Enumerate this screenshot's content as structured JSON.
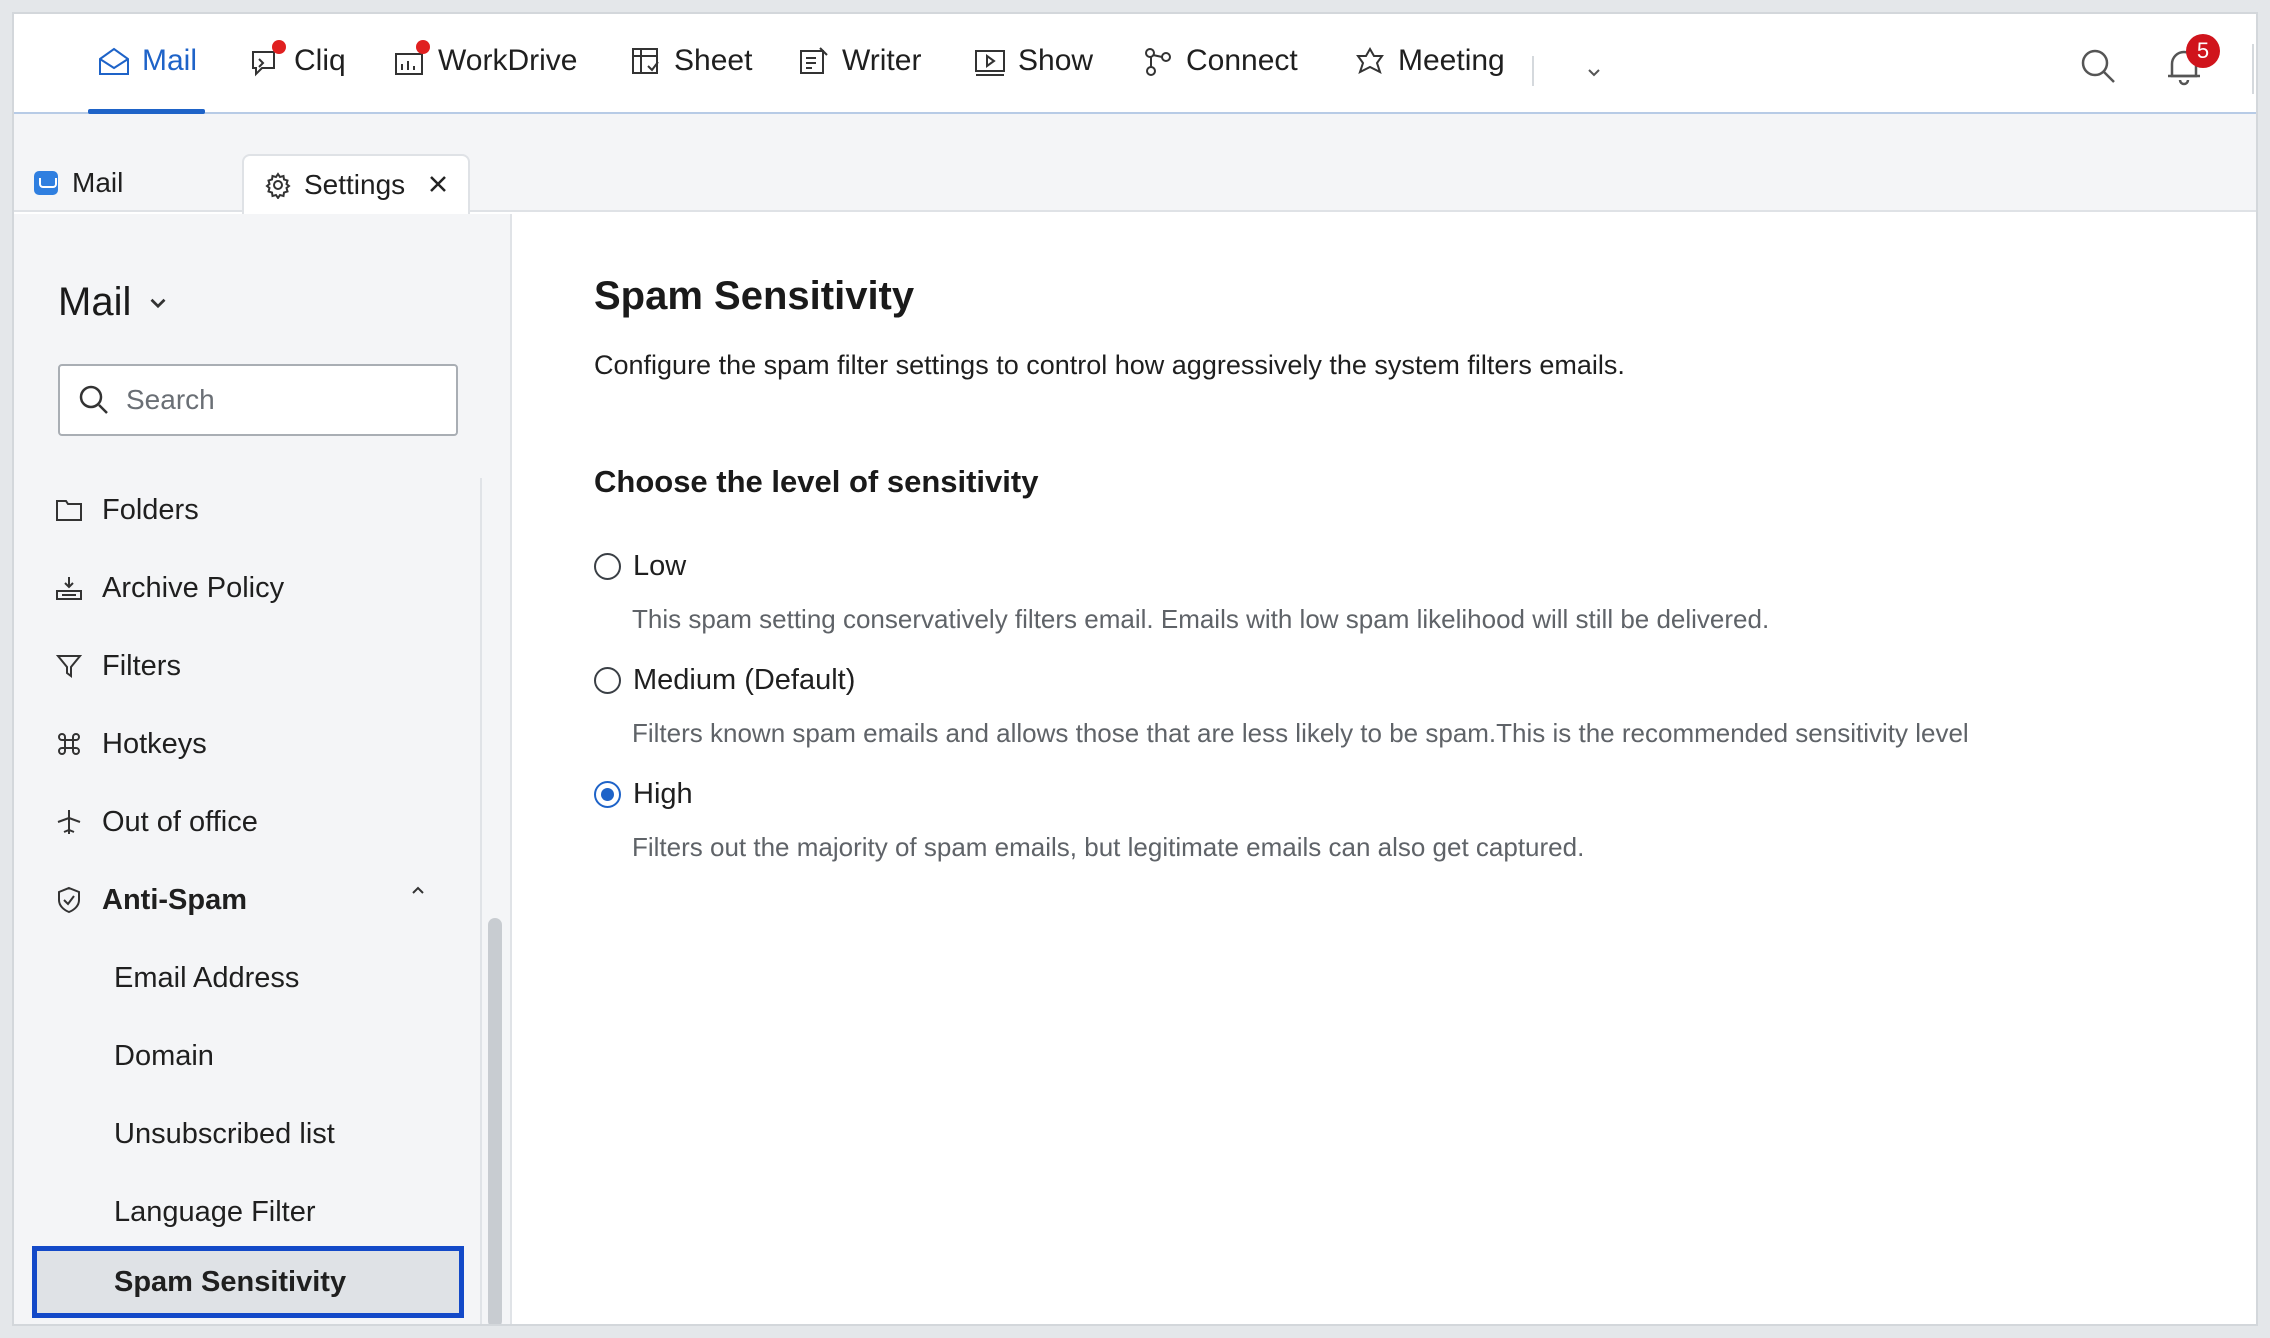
{
  "topbar": {
    "apps": [
      {
        "label": "Mail",
        "icon": "mail-app-icon",
        "active": true,
        "dot": false
      },
      {
        "label": "Cliq",
        "icon": "cliq-chat-icon",
        "active": false,
        "dot": true
      },
      {
        "label": "WorkDrive",
        "icon": "workdrive-icon",
        "active": false,
        "dot": true
      },
      {
        "label": "Sheet",
        "icon": "sheet-icon",
        "active": false,
        "dot": false
      },
      {
        "label": "Writer",
        "icon": "writer-icon",
        "active": false,
        "dot": false
      },
      {
        "label": "Show",
        "icon": "show-icon",
        "active": false,
        "dot": false
      },
      {
        "label": "Connect",
        "icon": "connect-icon",
        "active": false,
        "dot": false
      },
      {
        "label": "Meeting",
        "icon": "meeting-icon",
        "active": false,
        "dot": false
      }
    ],
    "notification_count": "5",
    "accent_color": "#1e63c8"
  },
  "tabs": {
    "mail_label": "Mail",
    "settings_label": "Settings"
  },
  "sidebar": {
    "title": "Mail",
    "search_placeholder": "Search",
    "items": [
      {
        "label": "Folders",
        "icon": "folder-icon"
      },
      {
        "label": "Archive Policy",
        "icon": "archive-icon"
      },
      {
        "label": "Filters",
        "icon": "filter-icon"
      },
      {
        "label": "Hotkeys",
        "icon": "command-key-icon"
      },
      {
        "label": "Out of office",
        "icon": "airplane-icon"
      },
      {
        "label": "Anti-Spam",
        "icon": "shield-check-icon"
      }
    ],
    "anti_spam_sub": [
      {
        "label": "Email Address"
      },
      {
        "label": "Domain"
      },
      {
        "label": "Unsubscribed list"
      },
      {
        "label": "Language Filter"
      },
      {
        "label": "Spam Sensitivity"
      }
    ]
  },
  "main": {
    "title": "Spam Sensitivity",
    "description": "Configure the spam filter settings to control how aggressively the system filters emails.",
    "section_title": "Choose the level of sensitivity",
    "options": [
      {
        "label": "Low",
        "description": "This spam setting conservatively filters email. Emails with low spam likelihood will still be delivered.",
        "checked": false
      },
      {
        "label": "Medium (Default)",
        "description": "Filters known spam emails and allows those that are less likely to be spam.This is the recommended sensitivity level",
        "checked": false
      },
      {
        "label": "High",
        "description": "Filters out the majority of spam emails, but legitimate emails can also get captured.",
        "checked": true
      }
    ]
  }
}
